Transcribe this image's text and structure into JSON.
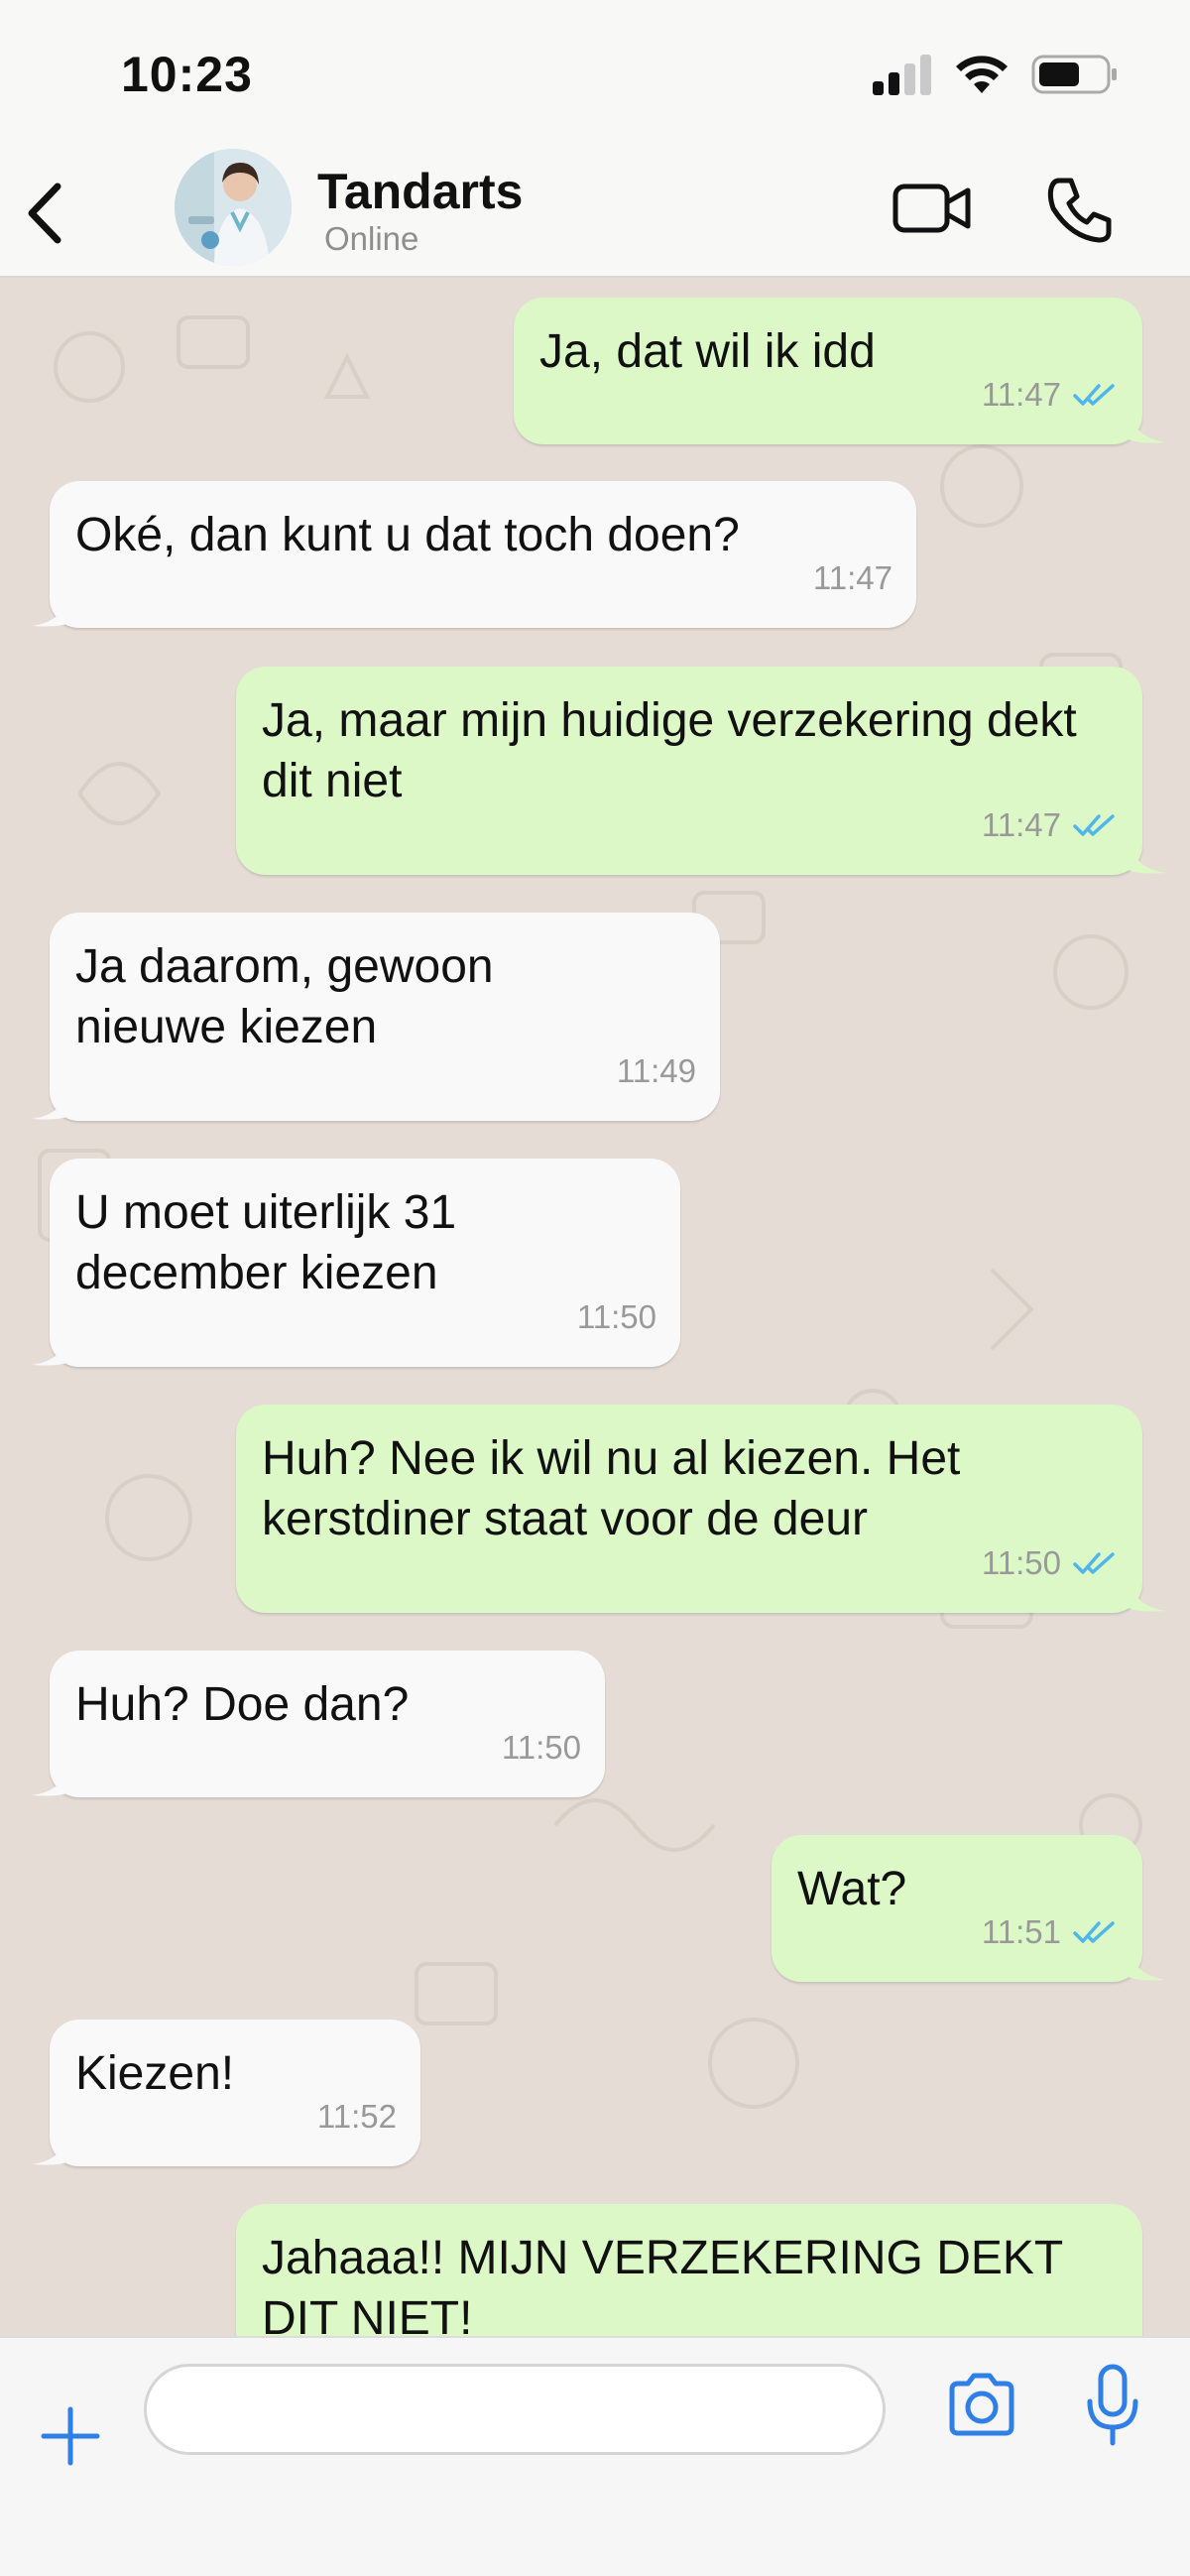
{
  "status_bar": {
    "time": "10:23"
  },
  "header": {
    "contact_name": "Tandarts",
    "contact_status": "Online"
  },
  "messages": [
    {
      "direction": "out",
      "text": "Ja, dat wil ik idd",
      "time": "11:47",
      "read": true
    },
    {
      "direction": "in",
      "text": "Oké, dan kunt u dat toch doen?",
      "time": "11:47"
    },
    {
      "direction": "out",
      "text": "Ja, maar mijn huidige verzekering dekt dit niet",
      "time": "11:47",
      "read": true
    },
    {
      "direction": "in",
      "text": "Ja daarom, gewoon nieuwe kiezen",
      "time": "11:49"
    },
    {
      "direction": "in",
      "text": "U moet uiterlijk 31 december kiezen",
      "time": "11:50"
    },
    {
      "direction": "out",
      "text": "Huh? Nee ik wil nu al kiezen. Het kerstdiner staat voor de deur",
      "time": "11:50",
      "read": true
    },
    {
      "direction": "in",
      "text": "Huh? Doe dan?",
      "time": "11:50"
    },
    {
      "direction": "out",
      "text": "Wat?",
      "time": "11:51",
      "read": true
    },
    {
      "direction": "in",
      "text": "Kiezen!",
      "time": "11:52"
    },
    {
      "direction": "out",
      "text": "Jahaaa!! MIJN VERZEKERING DEKT DIT NIET!",
      "time": "",
      "read": false
    }
  ],
  "composer": {
    "placeholder": ""
  },
  "colors": {
    "incoming_bubble": "#f9f9f9",
    "outgoing_bubble": "#dcf8c6",
    "chat_background": "#e5ddd5",
    "accent": "#2f7fe6",
    "read_ticks": "#4fb6ec"
  },
  "icons": {
    "back": "chevron-left-icon",
    "video": "video-camera-icon",
    "call": "phone-icon",
    "plus": "plus-icon",
    "camera": "camera-icon",
    "mic": "microphone-icon",
    "read": "double-check-icon"
  }
}
